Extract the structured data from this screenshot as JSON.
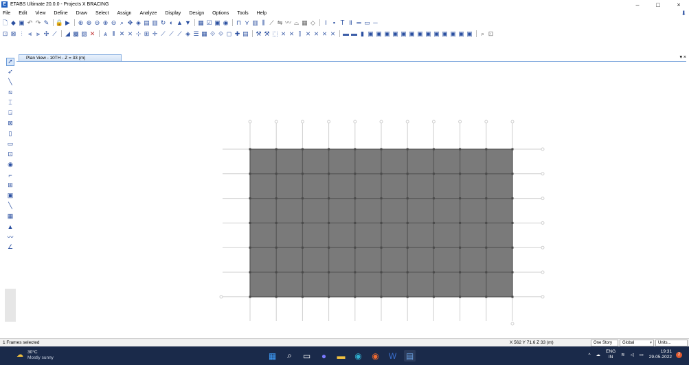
{
  "window": {
    "title": "ETABS Ultimate 20.0.0 - Projects X BRACING",
    "logo_letter": "E",
    "minimize": "–",
    "maximize": "□",
    "close": "×"
  },
  "menu": {
    "items": [
      "File",
      "Edit",
      "View",
      "Define",
      "Draw",
      "Select",
      "Assign",
      "Analyze",
      "Display",
      "Design",
      "Options",
      "Tools",
      "Help"
    ]
  },
  "view_tab": {
    "label": "Plan View - 10TH - Z = 33 (m)",
    "dropdown": "▾ ×"
  },
  "status": {
    "selection": "1 Frames selected",
    "coords": "X 562  Y 71.6  Z 33 (m)",
    "story_option": "One Story",
    "coord_system": "Global",
    "units": "Units..."
  },
  "taskbar": {
    "temperature": "30°C",
    "weather": "Mostly sunny",
    "lang_top": "ENG",
    "lang_bottom": "IN",
    "time": "19:31",
    "date": "29-05-2022",
    "notification_count": "2"
  },
  "plan_grid": {
    "columns": 10,
    "rows": 6,
    "slab_color": "#7a7a7a",
    "beam_color": "#5a5a5a",
    "grid_line_color": "#cfcfcf"
  }
}
